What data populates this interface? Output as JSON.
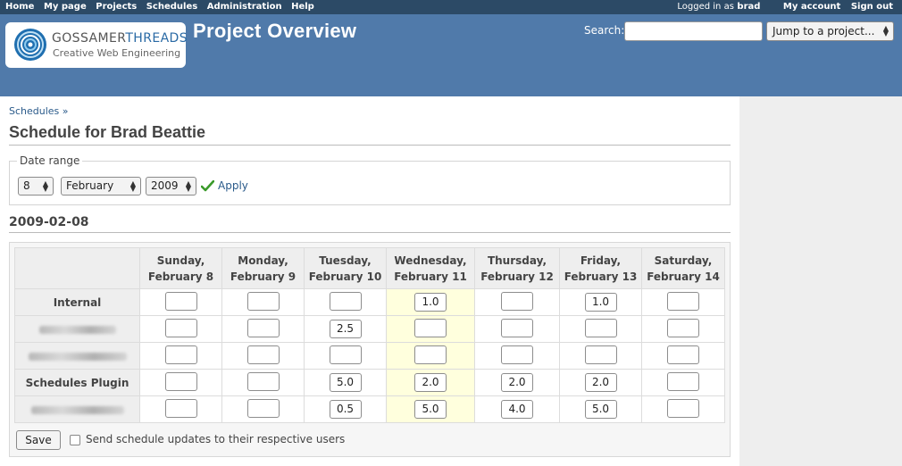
{
  "top_menu": {
    "items": [
      "Home",
      "My page",
      "Projects",
      "Schedules",
      "Administration",
      "Help"
    ],
    "logged_in_prefix": "Logged in as",
    "user": "brad",
    "my_account": "My account",
    "sign_out": "Sign out"
  },
  "header": {
    "logo_brand_a": "GOSSAMER",
    "logo_brand_b": "THREADS",
    "logo_tagline": "Creative Web Engineering",
    "project_title": "Project Overview",
    "search_label": "Search:",
    "search_value": "",
    "jump_select": "Jump to a project..."
  },
  "breadcrumb": "Schedules »",
  "page_title": "Schedule for Brad Beattie",
  "date_range": {
    "legend": "Date range",
    "day": "8",
    "month": "February",
    "year": "2009",
    "apply": "Apply"
  },
  "date_heading": "2009-02-08",
  "schedule": {
    "days": [
      {
        "line1": "Sunday,",
        "line2": "February 8"
      },
      {
        "line1": "Monday,",
        "line2": "February 9"
      },
      {
        "line1": "Tuesday,",
        "line2": "February 10"
      },
      {
        "line1": "Wednesday,",
        "line2": "February 11"
      },
      {
        "line1": "Thursday,",
        "line2": "February 12"
      },
      {
        "line1": "Friday,",
        "line2": "February 13"
      },
      {
        "line1": "Saturday,",
        "line2": "February 14"
      }
    ],
    "today_index": 3,
    "rows": [
      {
        "project": "Internal",
        "blurred": false,
        "values": [
          "",
          "",
          "",
          "1.0",
          "",
          "1.0",
          ""
        ]
      },
      {
        "project": "",
        "blurred": true,
        "values": [
          "",
          "",
          "2.5",
          "",
          "",
          "",
          ""
        ]
      },
      {
        "project": "",
        "blurred": true,
        "values": [
          "",
          "",
          "",
          "",
          "",
          "",
          ""
        ]
      },
      {
        "project": "Schedules Plugin",
        "blurred": false,
        "values": [
          "",
          "",
          "5.0",
          "2.0",
          "2.0",
          "2.0",
          ""
        ]
      },
      {
        "project": "",
        "blurred": true,
        "values": [
          "",
          "",
          "0.5",
          "5.0",
          "4.0",
          "5.0",
          ""
        ]
      }
    ]
  },
  "save_label": "Save",
  "notify_label": "Send schedule updates to their respective users",
  "colors": {
    "top_bar": "#2c4a66",
    "header": "#507aaa",
    "today_column": "#ffffdd",
    "link": "#2a5a8a"
  }
}
